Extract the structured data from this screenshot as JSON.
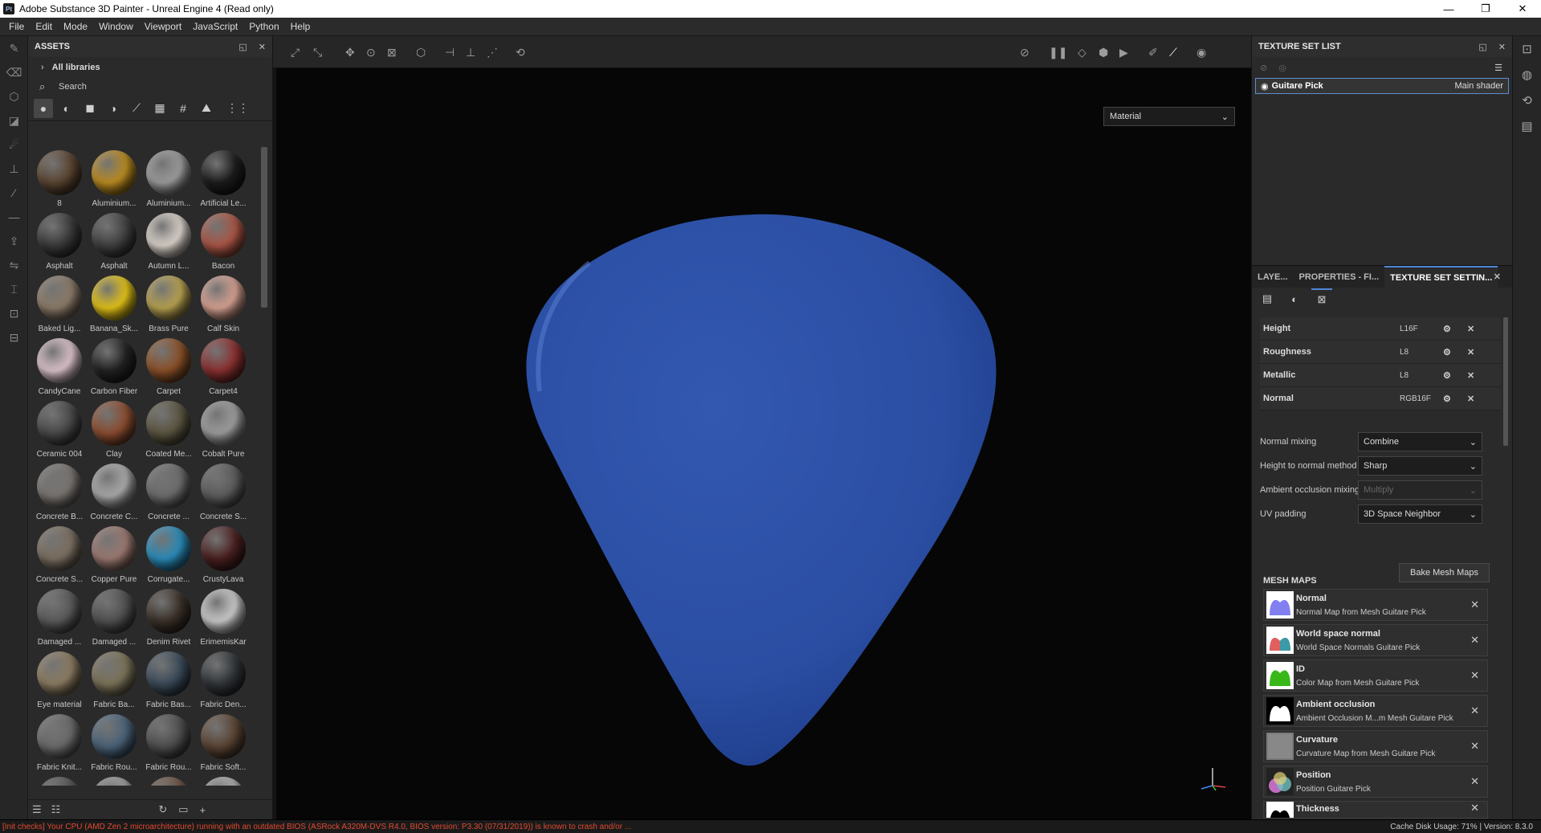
{
  "app": {
    "title": "Adobe Substance 3D Painter - Unreal Engine 4 (Read only)",
    "icon": "Pt"
  },
  "menu": [
    "File",
    "Edit",
    "Mode",
    "Window",
    "Viewport",
    "JavaScript",
    "Python",
    "Help"
  ],
  "assets": {
    "title": "ASSETS",
    "library": "All libraries",
    "search_placeholder": "Search",
    "items": [
      {
        "name": "8",
        "color": "#5a4430"
      },
      {
        "name": "Aluminium...",
        "color": "#b88a20"
      },
      {
        "name": "Aluminium...",
        "color": "#9a9a9a"
      },
      {
        "name": "Artificial Le...",
        "color": "#1c1c1c"
      },
      {
        "name": "Asphalt",
        "color": "#3a3a3a"
      },
      {
        "name": "Asphalt",
        "color": "#404040"
      },
      {
        "name": "Autumn L...",
        "color": "#d8d0c8"
      },
      {
        "name": "Bacon",
        "color": "#a85545"
      },
      {
        "name": "Baked Lig...",
        "color": "#8a7a68"
      },
      {
        "name": "Banana_Sk...",
        "color": "#e0c018"
      },
      {
        "name": "Brass Pure",
        "color": "#b5a050"
      },
      {
        "name": "Calf Skin",
        "color": "#d4a090"
      },
      {
        "name": "CandyCane",
        "color": "#d9c0c8"
      },
      {
        "name": "Carbon Fiber",
        "color": "#222222"
      },
      {
        "name": "Carpet",
        "color": "#8a5028"
      },
      {
        "name": "Carpet4",
        "color": "#8a3030"
      },
      {
        "name": "Ceramic 004",
        "color": "#484848"
      },
      {
        "name": "Clay",
        "color": "#8a4c30"
      },
      {
        "name": "Coated Me...",
        "color": "#5a5440"
      },
      {
        "name": "Cobalt Pure",
        "color": "#9c9c9c"
      },
      {
        "name": "Concrete B...",
        "color": "#787470"
      },
      {
        "name": "Concrete C...",
        "color": "#a8a8a8"
      },
      {
        "name": "Concrete ...",
        "color": "#6c6c6c"
      },
      {
        "name": "Concrete S...",
        "color": "#5c5c5c"
      },
      {
        "name": "Concrete S...",
        "color": "#7a6e60"
      },
      {
        "name": "Copper Pure",
        "color": "#9a7870"
      },
      {
        "name": "Corrugate...",
        "color": "#2a8ab8"
      },
      {
        "name": "CrustyLava",
        "color": "#4a2020"
      },
      {
        "name": "Damaged ...",
        "color": "#5a5a5a"
      },
      {
        "name": "Damaged ...",
        "color": "#505050"
      },
      {
        "name": "Denim Rivet",
        "color": "#3a3028"
      },
      {
        "name": "ErimemisKar",
        "color": "#c8c8c8"
      },
      {
        "name": "Eye material",
        "color": "#8a7a60"
      },
      {
        "name": "Fabric Ba...",
        "color": "#7a7258"
      },
      {
        "name": "Fabric Bas...",
        "color": "#3a4a58"
      },
      {
        "name": "Fabric Den...",
        "color": "#303438"
      },
      {
        "name": "Fabric Knit...",
        "color": "#6a6a6a"
      },
      {
        "name": "Fabric Rou...",
        "color": "#4a6278"
      },
      {
        "name": "Fabric Rou...",
        "color": "#4e4e4e"
      },
      {
        "name": "Fabric Soft...",
        "color": "#5a4434"
      },
      {
        "name": "",
        "color": "#555555"
      },
      {
        "name": "",
        "color": "#999999"
      },
      {
        "name": "",
        "color": "#6a5040"
      },
      {
        "name": "",
        "color": "#aaaaaa"
      }
    ]
  },
  "viewport": {
    "mode": "Material",
    "object_color": "#2c4fa6"
  },
  "texture_set_list": {
    "title": "TEXTURE SET LIST",
    "item": "Guitare Pick",
    "shader": "Main shader"
  },
  "tabs": {
    "layers": "LAYE...",
    "properties": "PROPERTIES - FI...",
    "tss": "TEXTURE SET SETTIN..."
  },
  "channels": [
    {
      "name": "Height",
      "format": "L16F"
    },
    {
      "name": "Roughness",
      "format": "L8"
    },
    {
      "name": "Metallic",
      "format": "L8"
    },
    {
      "name": "Normal",
      "format": "RGB16F"
    }
  ],
  "options": [
    {
      "label": "Normal mixing",
      "value": "Combine"
    },
    {
      "label": "Height to normal method",
      "value": "Sharp"
    },
    {
      "label": "Ambient occlusion mixing",
      "value": "Multiply"
    },
    {
      "label": "UV padding",
      "value": "3D Space Neighbor"
    }
  ],
  "mesh_maps": {
    "title": "MESH MAPS",
    "bake": "Bake Mesh Maps",
    "items": [
      {
        "name": "Normal",
        "desc": "Normal Map from Mesh Guitare Pick"
      },
      {
        "name": "World space normal",
        "desc": "World Space Normals Guitare Pick"
      },
      {
        "name": "ID",
        "desc": "Color Map from Mesh Guitare Pick"
      },
      {
        "name": "Ambient occlusion",
        "desc": "Ambient Occlusion M...m Mesh Guitare Pick"
      },
      {
        "name": "Curvature",
        "desc": "Curvature Map from Mesh Guitare Pick"
      },
      {
        "name": "Position",
        "desc": "Position Guitare Pick"
      },
      {
        "name": "Thickness",
        "desc": ""
      }
    ]
  },
  "status": {
    "warning": "[Init checks] Your CPU (AMD Zen 2 microarchitecture) running with an outdated BIOS (ASRock A320M-DVS R4.0, BIOS version: P3.30 (07/31/2019)) is known to crash and/or ...",
    "right": "Cache Disk Usage:    71% | Version: 8.3.0"
  }
}
